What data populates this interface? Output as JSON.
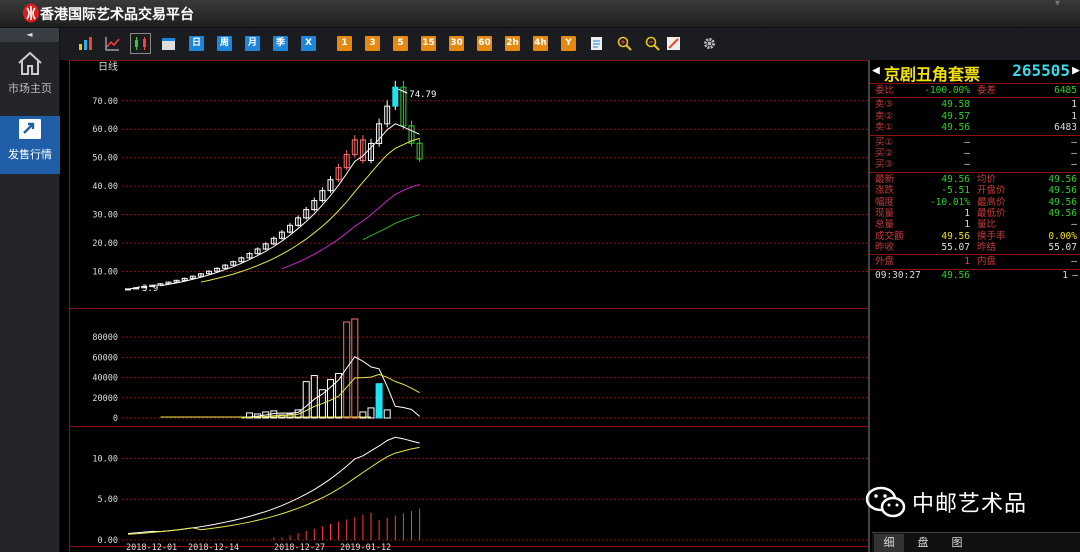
{
  "app": {
    "title": "香港国际艺术品交易平台"
  },
  "sidebar": {
    "collapse_glyph": "◄",
    "items": [
      {
        "label": "市场主页",
        "icon": "home-icon"
      },
      {
        "label": "发售行情",
        "icon": "market-chart-icon"
      }
    ]
  },
  "toolbar": {
    "buttons": [
      {
        "label": "",
        "icon": "bar-chart-icon"
      },
      {
        "label": "",
        "icon": "line-chart-icon"
      },
      {
        "label": "",
        "icon": "candlestick-icon"
      },
      {
        "label": "",
        "icon": "calendar-icon"
      },
      {
        "label": "日"
      },
      {
        "label": "周"
      },
      {
        "label": "月"
      },
      {
        "label": "季"
      },
      {
        "label": "X"
      },
      {
        "label": "1"
      },
      {
        "label": "3"
      },
      {
        "label": "5"
      },
      {
        "label": "15"
      },
      {
        "label": "30"
      },
      {
        "label": "60"
      },
      {
        "label": "2h"
      },
      {
        "label": "4h"
      },
      {
        "label": "Y"
      },
      {
        "label": "",
        "icon": "note-icon"
      },
      {
        "label": "",
        "icon": "zoom-in-icon"
      },
      {
        "label": "",
        "icon": "zoom-out-icon"
      },
      {
        "label": "",
        "icon": "draw-icon"
      },
      {
        "label": "",
        "icon": "gear-icon"
      }
    ]
  },
  "chart_data": [
    {
      "type": "candlestick",
      "title": "日线",
      "yticks": [
        "70.00",
        "60.00",
        "50.00",
        "40.00",
        "30.00",
        "20.00",
        "10.00"
      ],
      "ylim": [
        0,
        78
      ],
      "annotations": {
        "high": "74.79",
        "low": "3.9"
      },
      "close": [
        3.9,
        4.29,
        4.72,
        5.19,
        5.71,
        6.28,
        6.91,
        7.6,
        8.36,
        9.2,
        10.12,
        11.13,
        12.24,
        13.46,
        14.81,
        16.29,
        17.92,
        19.71,
        21.68,
        23.85,
        26.24,
        28.86,
        31.75,
        34.93,
        38.42,
        42.26,
        46.49,
        51.14,
        56.25,
        49.0,
        55.0,
        61.9,
        68.1,
        74.79,
        61.19,
        55.07,
        49.56
      ],
      "ma_white": [
        null,
        null,
        null,
        null,
        5.0,
        5.5,
        6.0,
        6.6,
        7.3,
        8.0,
        8.8,
        9.7,
        10.7,
        11.7,
        12.9,
        14.2,
        15.6,
        17.1,
        18.8,
        20.7,
        22.8,
        25.1,
        27.6,
        30.3,
        33.4,
        36.7,
        40.4,
        44.4,
        48.7,
        50.6,
        53.6,
        56.5,
        59.8,
        61.9,
        60.8,
        59.5,
        58.2
      ],
      "ma_yellow": [
        null,
        null,
        null,
        null,
        null,
        null,
        null,
        null,
        null,
        6.3,
        6.9,
        7.6,
        8.3,
        9.1,
        10.0,
        11.0,
        12.1,
        13.3,
        14.6,
        16.1,
        17.7,
        19.5,
        21.4,
        23.6,
        25.9,
        28.5,
        31.4,
        34.5,
        38.0,
        41.4,
        44.7,
        48.0,
        51.1,
        53.3,
        54.6,
        55.9,
        56.8
      ],
      "ma_magenta": [
        null,
        null,
        null,
        null,
        null,
        null,
        null,
        null,
        null,
        null,
        null,
        null,
        null,
        null,
        null,
        null,
        null,
        null,
        null,
        11.0,
        12.1,
        13.3,
        14.6,
        16.1,
        17.7,
        19.5,
        21.4,
        23.6,
        25.9,
        27.8,
        30.0,
        32.4,
        34.9,
        37.1,
        38.5,
        39.7,
        40.6
      ],
      "ma_green": [
        null,
        null,
        null,
        null,
        null,
        null,
        null,
        null,
        null,
        null,
        null,
        null,
        null,
        null,
        null,
        null,
        null,
        null,
        null,
        null,
        null,
        null,
        null,
        null,
        null,
        null,
        null,
        null,
        null,
        21.2,
        22.6,
        24.0,
        25.4,
        27.0,
        28.1,
        29.1,
        30.0
      ]
    },
    {
      "type": "bar",
      "title": "volume",
      "yticks": [
        "80000",
        "60000",
        "40000",
        "20000",
        "0"
      ],
      "ylim": [
        0,
        95000
      ],
      "values": [
        0,
        0,
        0,
        0,
        0,
        0,
        0,
        0,
        0,
        0,
        0,
        0,
        0,
        0,
        0,
        5000,
        4000,
        6000,
        7000,
        3000,
        4000,
        8000,
        36000,
        42000,
        28000,
        38000,
        44000,
        95000,
        98000,
        6000,
        10000,
        34000,
        8000,
        0,
        0,
        0,
        0
      ],
      "ma_white": [],
      "ma_yellow": []
    },
    {
      "type": "line",
      "title": "indicator",
      "yticks": [
        "10.00",
        "5.00",
        "0.00"
      ],
      "ylim": [
        0,
        13
      ]
    }
  ],
  "xaxis": {
    "labels": [
      "2018-12-01",
      "2018-12-14",
      "2018-12-27",
      "2019-01-12"
    ]
  },
  "quote": {
    "name": "京剧丑角套票",
    "code": "265505",
    "weibi_label": "委比",
    "weibi_value": "-100.00%",
    "weicha_label": "委差",
    "weicha_value": "6485",
    "asks": [
      {
        "label": "卖③",
        "price": "49.58",
        "qty": "1"
      },
      {
        "label": "卖②",
        "price": "49.57",
        "qty": "1"
      },
      {
        "label": "卖①",
        "price": "49.56",
        "qty": "6483"
      }
    ],
    "bids": [
      {
        "label": "买①",
        "price": "—",
        "qty": "—"
      },
      {
        "label": "买②",
        "price": "—",
        "qty": "—"
      },
      {
        "label": "买③",
        "price": "—",
        "qty": "—"
      }
    ],
    "stats": [
      {
        "l1": "最新",
        "v1": "49.56",
        "l2": "均价",
        "v2": "49.56"
      },
      {
        "l1": "涨跌",
        "v1": "-5.51",
        "l2": "开盘价",
        "v2": "49.56"
      },
      {
        "l1": "幅度",
        "v1": "-10.01%",
        "l2": "最高价",
        "v2": "49.56"
      },
      {
        "l1": "现量",
        "v1": "1",
        "l2": "最低价",
        "v2": "49.56"
      },
      {
        "l1": "总量",
        "v1": "1",
        "l2": "量比",
        "v2": "—"
      },
      {
        "l1": "成交额",
        "v1": "49.56",
        "l2": "换手率",
        "v2": "0.00%"
      },
      {
        "l1": "昨收",
        "v1": "55.07",
        "l2": "昨结",
        "v2": "55.07"
      }
    ],
    "outer_label": "外盘",
    "outer_value": "1",
    "inner_label": "内盘",
    "inner_value": "—",
    "tick": {
      "time": "09:30:27",
      "price": "49.56",
      "qty": "1",
      "dir": "—"
    }
  },
  "tabs": [
    "细",
    "盘",
    "图"
  ],
  "watermark": {
    "text": "中邮艺术品",
    "icon": "wechat-icon"
  },
  "colors": {
    "up": "#ff3b3b",
    "down": "#28d228",
    "accent_blue": "#1e86d8",
    "accent_orange": "#e48a12",
    "grid": "#8b1010"
  }
}
